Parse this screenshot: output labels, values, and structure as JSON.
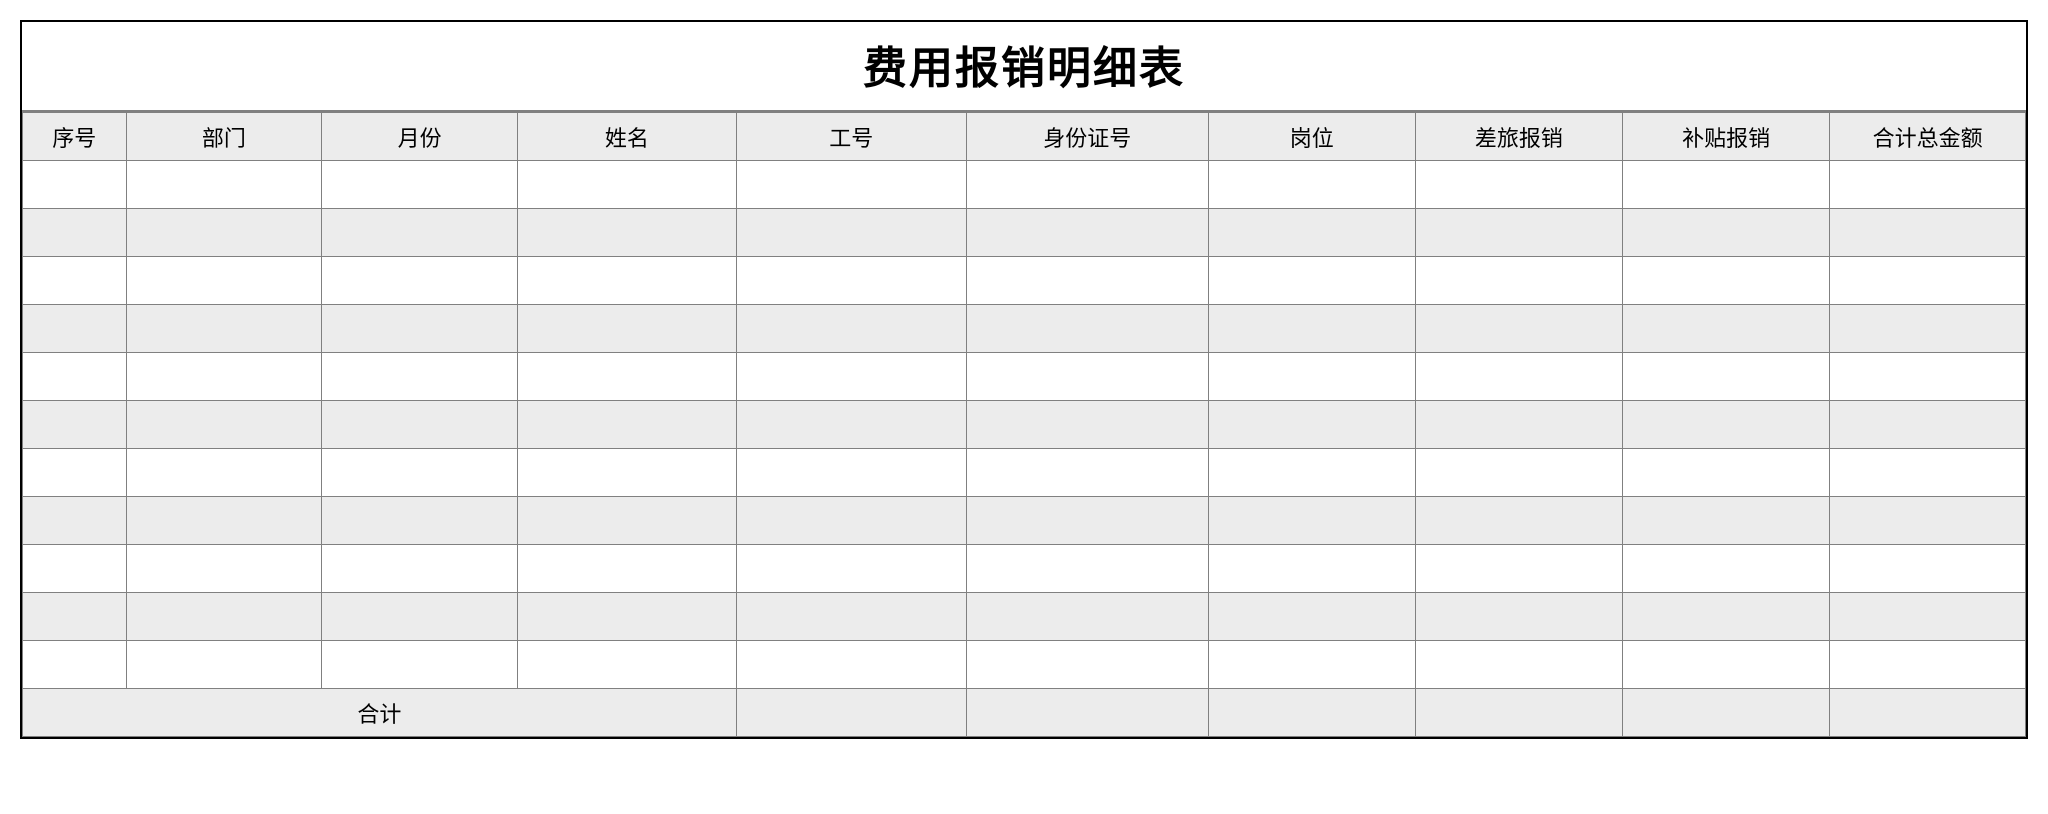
{
  "title": "费用报销明细表",
  "columns": [
    "序号",
    "部门",
    "月份",
    "姓名",
    "工号",
    "身份证号",
    "岗位",
    "差旅报销",
    "补贴报销",
    "合计总金额"
  ],
  "rows": [
    [
      "",
      "",
      "",
      "",
      "",
      "",
      "",
      "",
      "",
      ""
    ],
    [
      "",
      "",
      "",
      "",
      "",
      "",
      "",
      "",
      "",
      ""
    ],
    [
      "",
      "",
      "",
      "",
      "",
      "",
      "",
      "",
      "",
      ""
    ],
    [
      "",
      "",
      "",
      "",
      "",
      "",
      "",
      "",
      "",
      ""
    ],
    [
      "",
      "",
      "",
      "",
      "",
      "",
      "",
      "",
      "",
      ""
    ],
    [
      "",
      "",
      "",
      "",
      "",
      "",
      "",
      "",
      "",
      ""
    ],
    [
      "",
      "",
      "",
      "",
      "",
      "",
      "",
      "",
      "",
      ""
    ],
    [
      "",
      "",
      "",
      "",
      "",
      "",
      "",
      "",
      "",
      ""
    ],
    [
      "",
      "",
      "",
      "",
      "",
      "",
      "",
      "",
      "",
      ""
    ],
    [
      "",
      "",
      "",
      "",
      "",
      "",
      "",
      "",
      "",
      ""
    ],
    [
      "",
      "",
      "",
      "",
      "",
      "",
      "",
      "",
      "",
      ""
    ]
  ],
  "footer": {
    "label": "合计",
    "values": [
      "",
      "",
      "",
      "",
      "",
      ""
    ]
  }
}
